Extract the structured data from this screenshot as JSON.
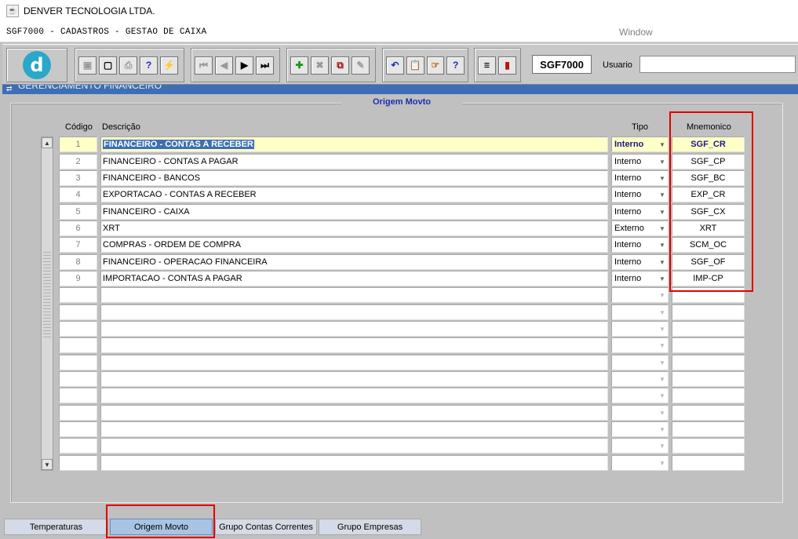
{
  "window": {
    "title": "DENVER TECNOLOGIA LTDA.",
    "app_icon": "java-cup-icon"
  },
  "menubar": {
    "form_title": "SGF7000 - CADASTROS - GESTAO DE CAIXA",
    "window_menu": "Window"
  },
  "toolbar": {
    "form_code": "SGF7000",
    "usuario_label": "Usuario",
    "usuario_value": ""
  },
  "panel": {
    "header": "GERENCIAMENTO FINANCEIRO",
    "frame_title": "Origem Movto"
  },
  "columns": {
    "codigo": "Código",
    "descricao": "Descrição",
    "tipo": "Tipo",
    "mnemonico": "Mnemonico"
  },
  "rows": [
    {
      "codigo": "1",
      "descricao": "FINANCEIRO - CONTAS A RECEBER",
      "tipo": "Interno",
      "mnemonico": "SGF_CR"
    },
    {
      "codigo": "2",
      "descricao": "FINANCEIRO - CONTAS A PAGAR",
      "tipo": "Interno",
      "mnemonico": "SGF_CP"
    },
    {
      "codigo": "3",
      "descricao": "FINANCEIRO - BANCOS",
      "tipo": "Interno",
      "mnemonico": "SGF_BC"
    },
    {
      "codigo": "4",
      "descricao": "EXPORTACAO - CONTAS A RECEBER",
      "tipo": "Interno",
      "mnemonico": "EXP_CR"
    },
    {
      "codigo": "5",
      "descricao": "FINANCEIRO - CAIXA",
      "tipo": "Interno",
      "mnemonico": "SGF_CX"
    },
    {
      "codigo": "6",
      "descricao": "XRT",
      "tipo": "Externo",
      "mnemonico": "XRT"
    },
    {
      "codigo": "7",
      "descricao": "COMPRAS - ORDEM DE COMPRA",
      "tipo": "Interno",
      "mnemonico": "SCM_OC"
    },
    {
      "codigo": "8",
      "descricao": "FINANCEIRO - OPERACAO FINANCEIRA",
      "tipo": "Interno",
      "mnemonico": "SGF_OF"
    },
    {
      "codigo": "9",
      "descricao": "IMPORTACAO - CONTAS A PAGAR",
      "tipo": "Interno",
      "mnemonico": "IMP-CP"
    }
  ],
  "tabs": [
    {
      "label": "Temperaturas"
    },
    {
      "label": "Origem Movto"
    },
    {
      "label": "Grupo Contas Correntes"
    },
    {
      "label": "Grupo Empresas"
    }
  ],
  "colors": {
    "accent": "#3c6fb5",
    "highlight": "#e00000",
    "active_row": "#ffffc8"
  }
}
